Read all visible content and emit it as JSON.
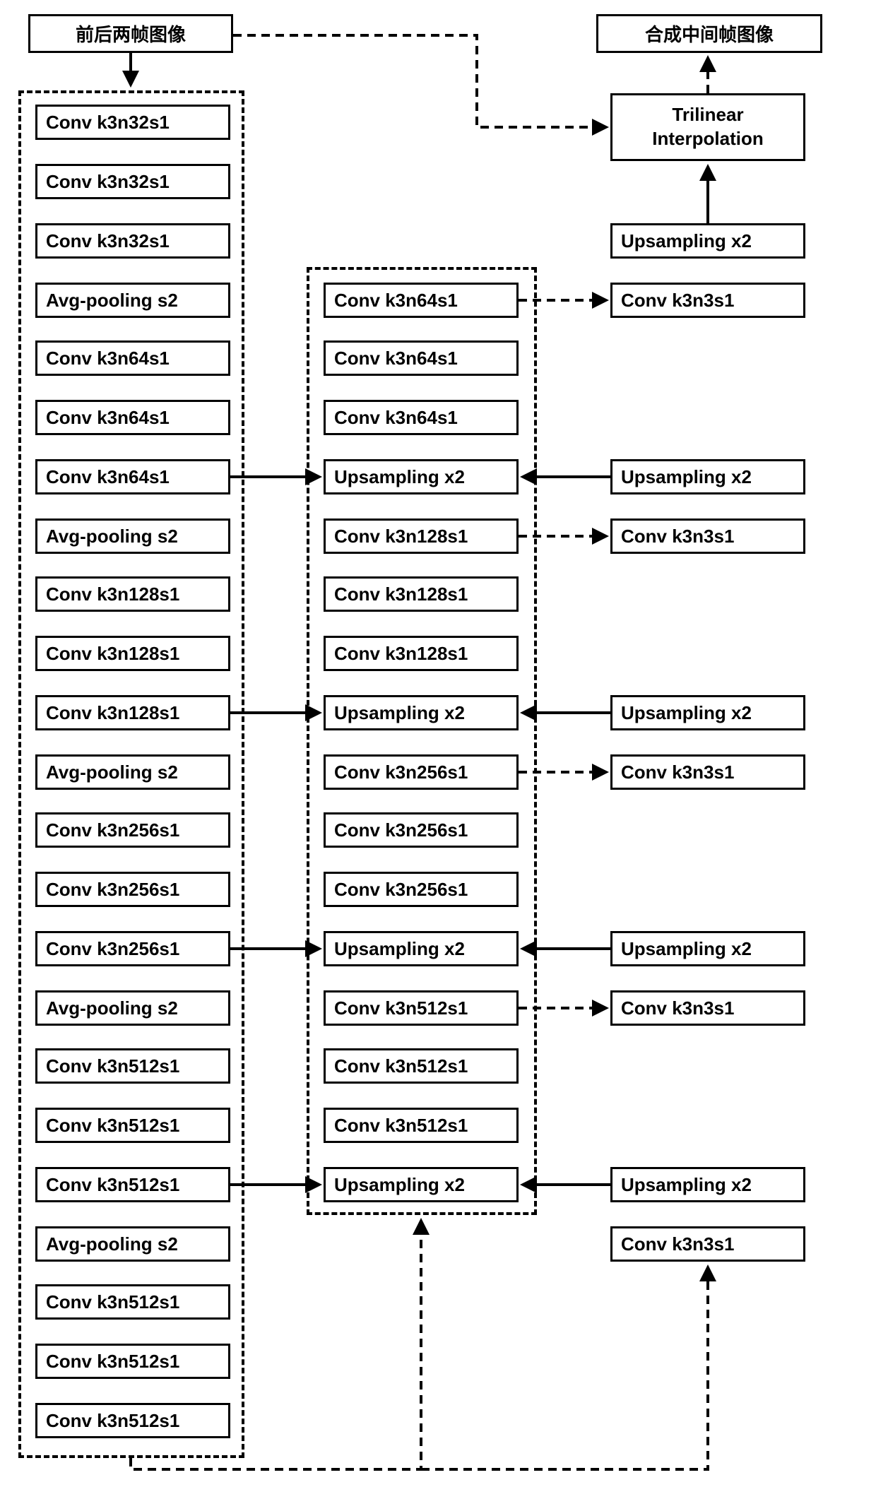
{
  "header": {
    "input": "前后两帧图像",
    "output": "合成中间帧图像"
  },
  "encoder": {
    "b1": "Conv k3n32s1",
    "b2": "Conv k3n32s1",
    "b3": "Conv k3n32s1",
    "b4": "Avg-pooling s2",
    "b5": "Conv k3n64s1",
    "b6": "Conv k3n64s1",
    "b7": "Conv k3n64s1",
    "b8": "Avg-pooling s2",
    "b9": "Conv k3n128s1",
    "b10": "Conv k3n128s1",
    "b11": "Conv k3n128s1",
    "b12": "Avg-pooling s2",
    "b13": "Conv k3n256s1",
    "b14": "Conv k3n256s1",
    "b15": "Conv k3n256s1",
    "b16": "Avg-pooling s2",
    "b17": "Conv k3n512s1",
    "b18": "Conv k3n512s1",
    "b19": "Conv k3n512s1",
    "b20": "Avg-pooling s2",
    "b21": "Conv k3n512s1",
    "b22": "Conv k3n512s1",
    "b23": "Conv k3n512s1"
  },
  "decoder": {
    "d1": "Conv k3n64s1",
    "d2": "Conv k3n64s1",
    "d3": "Conv k3n64s1",
    "d4": "Upsampling x2",
    "d5": "Conv k3n128s1",
    "d6": "Conv k3n128s1",
    "d7": "Conv k3n128s1",
    "d8": "Upsampling x2",
    "d9": "Conv k3n256s1",
    "d10": "Conv k3n256s1",
    "d11": "Conv k3n256s1",
    "d12": "Upsampling x2",
    "d13": "Conv k3n512s1",
    "d14": "Conv k3n512s1",
    "d15": "Conv k3n512s1",
    "d16": "Upsampling x2"
  },
  "right": {
    "r1_line1": "Trilinear",
    "r1_line2": "Interpolation",
    "r2": "Upsampling x2",
    "r3": "Conv k3n3s1",
    "r4": "Upsampling x2",
    "r5": "Conv k3n3s1",
    "r6": "Upsampling x2",
    "r7": "Conv k3n3s1",
    "r8": "Upsampling x2",
    "r9": "Conv k3n3s1",
    "r10": "Upsampling x2",
    "r11": "Conv k3n3s1"
  }
}
